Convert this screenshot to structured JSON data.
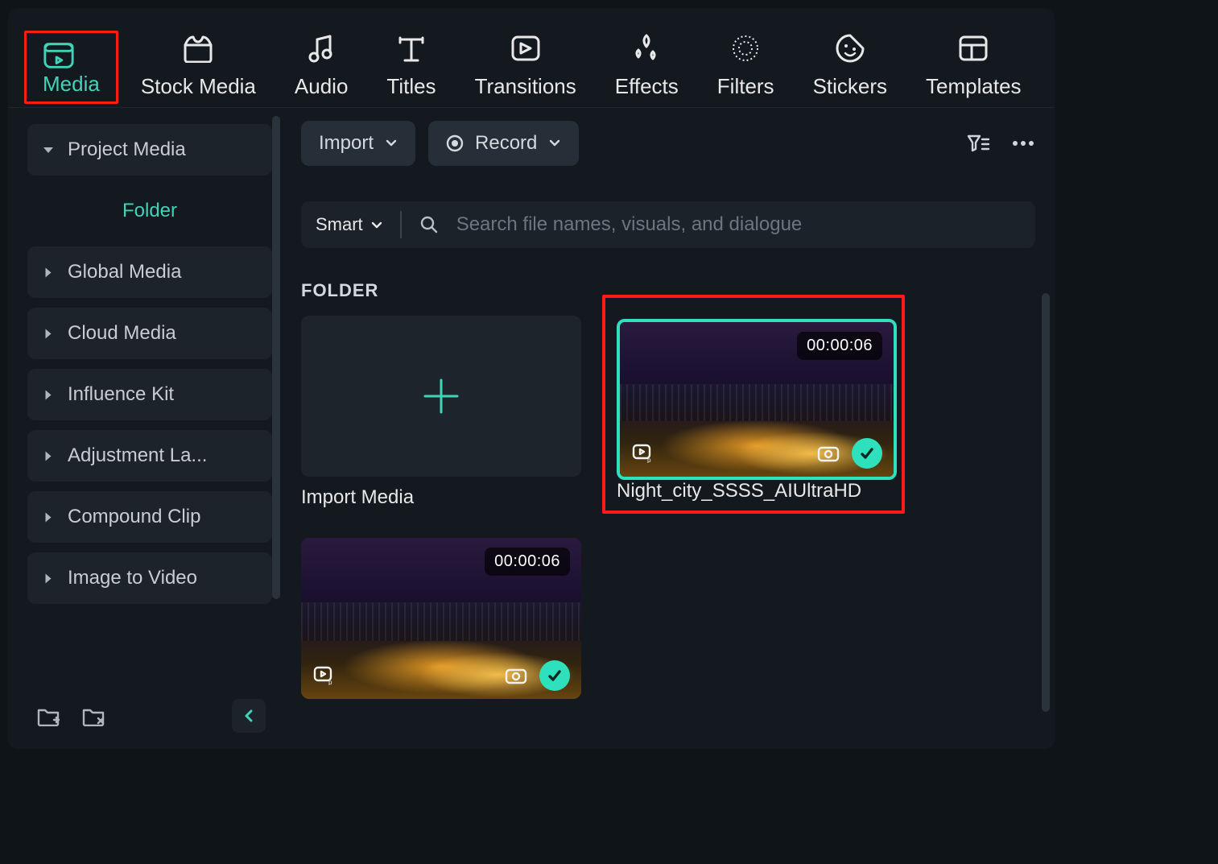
{
  "tabs": [
    {
      "id": "media",
      "label": "Media",
      "active": true,
      "highlight": true
    },
    {
      "id": "stock-media",
      "label": "Stock Media"
    },
    {
      "id": "audio",
      "label": "Audio"
    },
    {
      "id": "titles",
      "label": "Titles"
    },
    {
      "id": "transitions",
      "label": "Transitions"
    },
    {
      "id": "effects",
      "label": "Effects"
    },
    {
      "id": "filters",
      "label": "Filters"
    },
    {
      "id": "stickers",
      "label": "Stickers"
    },
    {
      "id": "templates",
      "label": "Templates"
    }
  ],
  "sidebar": {
    "items": [
      {
        "id": "project-media",
        "label": "Project Media",
        "expanded": true
      },
      {
        "id": "folder",
        "label": "Folder",
        "sub": true,
        "active": true
      },
      {
        "id": "global-media",
        "label": "Global Media"
      },
      {
        "id": "cloud-media",
        "label": "Cloud Media"
      },
      {
        "id": "influence-kit",
        "label": "Influence Kit"
      },
      {
        "id": "adjustment-layer",
        "label": "Adjustment La..."
      },
      {
        "id": "compound-clip",
        "label": "Compound Clip"
      },
      {
        "id": "image-to-video",
        "label": "Image to Video"
      }
    ]
  },
  "toolbar": {
    "import_label": "Import",
    "record_label": "Record"
  },
  "search": {
    "mode": "Smart",
    "placeholder": "Search file names, visuals, and dialogue"
  },
  "section_label": "FOLDER",
  "cards": {
    "import_label": "Import Media",
    "clip1": {
      "name": "Night_city_SSSS_AIUltraHD",
      "duration": "00:00:06",
      "selected": true,
      "highlight": true
    },
    "clip2": {
      "duration": "00:00:06"
    }
  },
  "colors": {
    "accent": "#3fd4b8",
    "highlight": "#ff1a1a"
  }
}
